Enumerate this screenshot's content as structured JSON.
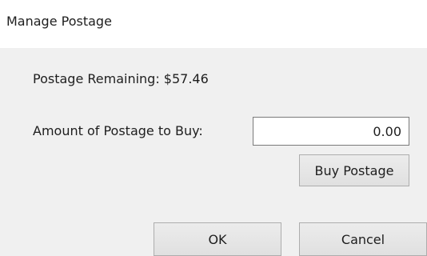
{
  "window": {
    "title": "Manage Postage"
  },
  "postage": {
    "remaining_text": "Postage Remaining: $57.46"
  },
  "purchase": {
    "amount_label": "Amount of Postage to Buy:",
    "amount_value": "0.00",
    "buy_label": "Buy Postage"
  },
  "actions": {
    "ok_label": "OK",
    "cancel_label": "Cancel"
  }
}
